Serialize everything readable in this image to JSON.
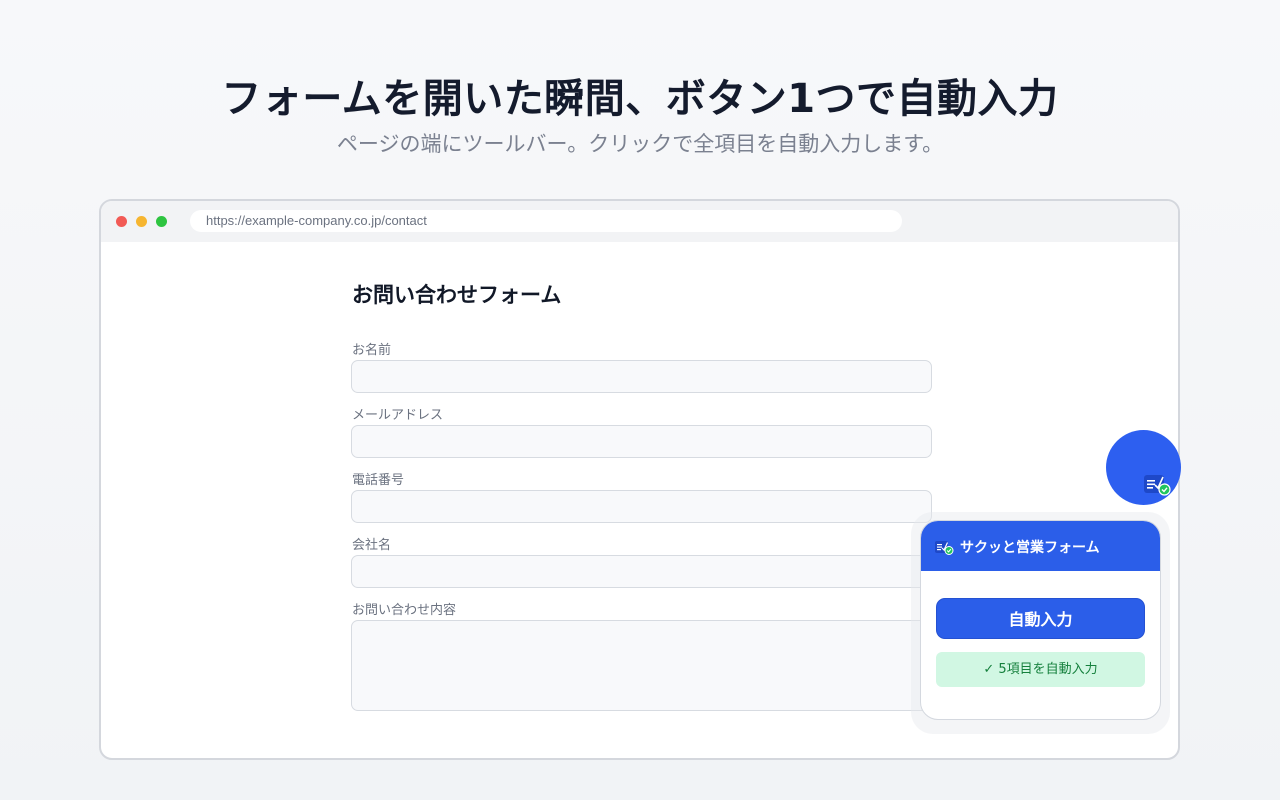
{
  "hero": {
    "headline": "フォームを開いた瞬間、ボタン1つで自動入力",
    "subline": "ページの端にツールバー。クリックで全項目を自動入力します。"
  },
  "browser": {
    "url": "https://example-company.co.jp/contact"
  },
  "form": {
    "title": "お問い合わせフォーム",
    "fields": [
      {
        "label": "お名前",
        "value": ""
      },
      {
        "label": "メールアドレス",
        "value": ""
      },
      {
        "label": "電話番号",
        "value": ""
      },
      {
        "label": "会社名",
        "value": ""
      },
      {
        "label": "お問い合わせ内容",
        "value": ""
      }
    ]
  },
  "extension": {
    "fab_icon": "form-check-icon",
    "title": "サクッと営業フォーム",
    "header_icon": "form-check-icon",
    "autofill_label": "自動入力",
    "status": "✓ 5項目を自動入力"
  },
  "colors": {
    "accent": "#2b5ee9",
    "success_bg": "#d1f7e3",
    "success_text": "#15803d"
  }
}
